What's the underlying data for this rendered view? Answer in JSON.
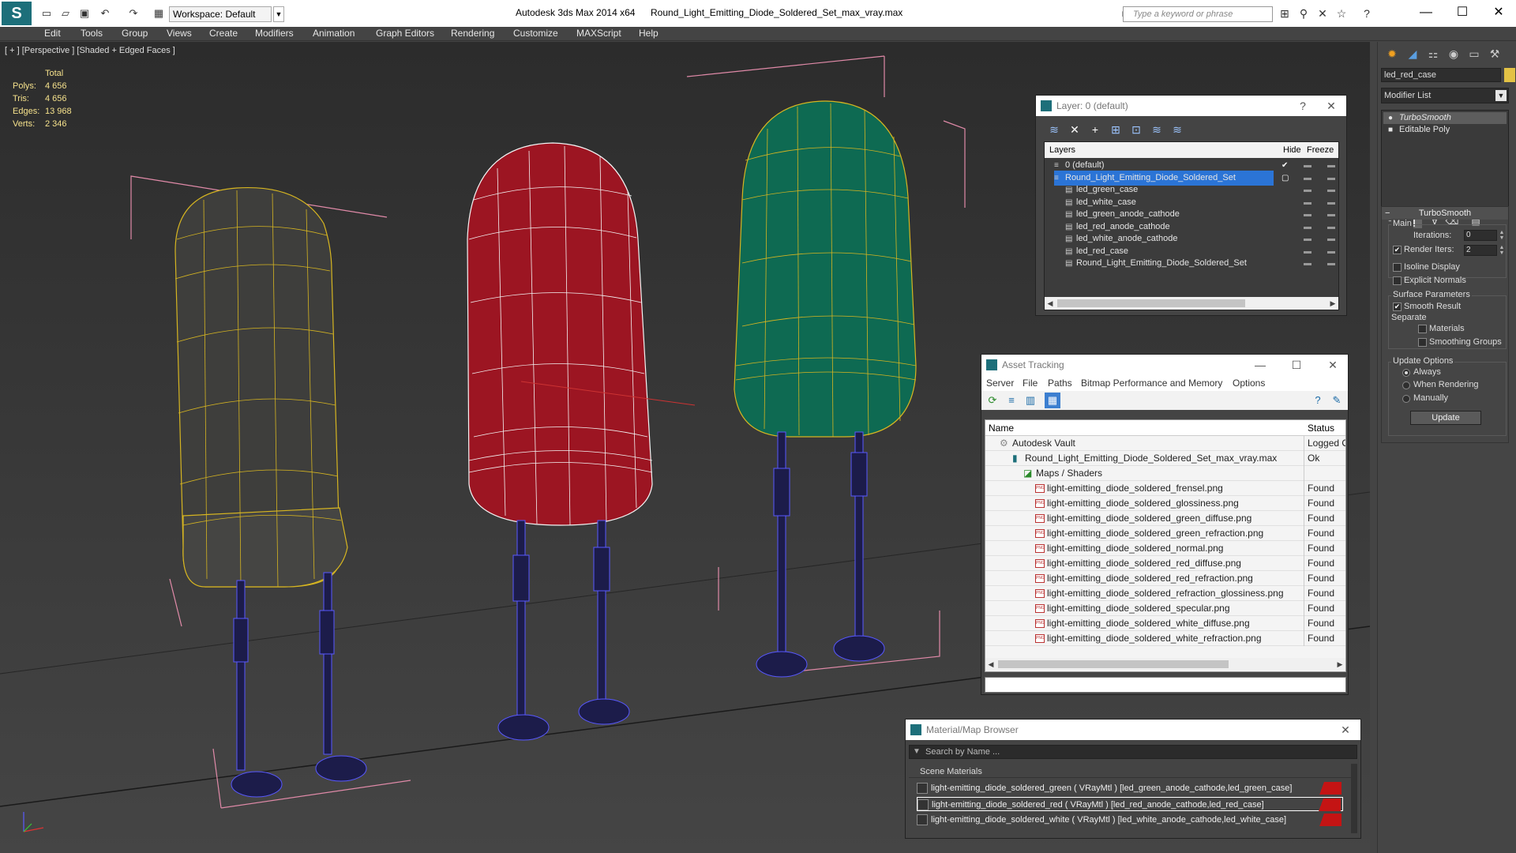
{
  "titlebar": {
    "workspace": "Workspace: Default",
    "app_title": "Autodesk 3ds Max  2014 x64",
    "doc_title": "Round_Light_Emitting_Diode_Soldered_Set_max_vray.max",
    "search_placeholder": "Type a keyword or phrase"
  },
  "menu": [
    "Edit",
    "Tools",
    "Group",
    "Views",
    "Create",
    "Modifiers",
    "Animation",
    "Graph Editors",
    "Rendering",
    "Customize",
    "MAXScript",
    "Help"
  ],
  "viewport": {
    "label": "[ + ] [Perspective ] [Shaded + Edged Faces ]",
    "stats": {
      "header": "Total",
      "polys_label": "Polys:",
      "polys": "4 656",
      "tris_label": "Tris:",
      "tris": "4 656",
      "edges_label": "Edges:",
      "edges": "13 968",
      "verts_label": "Verts:",
      "verts": "2 346"
    }
  },
  "command_panel": {
    "object_name": "led_red_case",
    "object_color": "#e3c245",
    "modifier_list": "Modifier List",
    "stack": [
      "TurboSmooth",
      "Editable Poly"
    ],
    "turbosmooth": {
      "title": "TurboSmooth",
      "main": "Main",
      "iterations_label": "Iterations:",
      "iterations": "0",
      "render_iters_label": "Render Iters:",
      "render_iters": "2",
      "isoline": "Isoline Display",
      "explicit_normals": "Explicit Normals",
      "surface_params": "Surface Parameters",
      "smooth_result": "Smooth Result",
      "separate": "Separate",
      "materials": "Materials",
      "smoothing_groups": "Smoothing Groups",
      "update_options": "Update Options",
      "always": "Always",
      "when_rendering": "When Rendering",
      "manually": "Manually",
      "update_button": "Update"
    }
  },
  "layer_window": {
    "title": "Layer: 0 (default)",
    "col_layers": "Layers",
    "col_hide": "Hide",
    "col_freeze": "Freeze",
    "rows": [
      {
        "name": "0 (default)",
        "indent": 0
      },
      {
        "name": "Round_Light_Emitting_Diode_Soldered_Set",
        "indent": 0,
        "selected": true
      },
      {
        "name": "led_green_case",
        "indent": 1
      },
      {
        "name": "led_white_case",
        "indent": 1
      },
      {
        "name": "led_green_anode_cathode",
        "indent": 1
      },
      {
        "name": "led_red_anode_cathode",
        "indent": 1
      },
      {
        "name": "led_white_anode_cathode",
        "indent": 1
      },
      {
        "name": "led_red_case",
        "indent": 1
      },
      {
        "name": "Round_Light_Emitting_Diode_Soldered_Set",
        "indent": 1
      }
    ]
  },
  "asset_window": {
    "title": "Asset Tracking",
    "menu": [
      "Server",
      "File",
      "Paths",
      "Bitmap Performance and Memory",
      "Options"
    ],
    "col_name": "Name",
    "col_status": "Status",
    "rows": [
      {
        "name": "Autodesk Vault",
        "status": "Logged Out",
        "level": 0
      },
      {
        "name": "Round_Light_Emitting_Diode_Soldered_Set_max_vray.max",
        "status": "Ok",
        "level": 1
      },
      {
        "name": "Maps / Shaders",
        "status": "",
        "level": 2
      },
      {
        "name": "light-emitting_diode_soldered_frensel.png",
        "status": "Found",
        "level": 3
      },
      {
        "name": "light-emitting_diode_soldered_glossiness.png",
        "status": "Found",
        "level": 3
      },
      {
        "name": "light-emitting_diode_soldered_green_diffuse.png",
        "status": "Found",
        "level": 3
      },
      {
        "name": "light-emitting_diode_soldered_green_refraction.png",
        "status": "Found",
        "level": 3
      },
      {
        "name": "light-emitting_diode_soldered_normal.png",
        "status": "Found",
        "level": 3
      },
      {
        "name": "light-emitting_diode_soldered_red_diffuse.png",
        "status": "Found",
        "level": 3
      },
      {
        "name": "light-emitting_diode_soldered_red_refraction.png",
        "status": "Found",
        "level": 3
      },
      {
        "name": "light-emitting_diode_soldered_refraction_glossiness.png",
        "status": "Found",
        "level": 3
      },
      {
        "name": "light-emitting_diode_soldered_specular.png",
        "status": "Found",
        "level": 3
      },
      {
        "name": "light-emitting_diode_soldered_white_diffuse.png",
        "status": "Found",
        "level": 3
      },
      {
        "name": "light-emitting_diode_soldered_white_refraction.png",
        "status": "Found",
        "level": 3
      }
    ]
  },
  "material_window": {
    "title": "Material/Map Browser",
    "search_placeholder": "Search by Name ...",
    "section": "Scene Materials",
    "materials": [
      "light-emitting_diode_soldered_green ( VRayMtl ) [led_green_anode_cathode,led_green_case]",
      "light-emitting_diode_soldered_red ( VRayMtl ) [led_red_anode_cathode,led_red_case]",
      "light-emitting_diode_soldered_white ( VRayMtl ) [led_white_anode_cathode,led_white_case]"
    ]
  },
  "colors": {
    "green_led": "#0e6a52",
    "red_led": "#9c1522",
    "white_led": "#4a4a48",
    "leads": "#2a2a6a",
    "selection": "#2b74d6"
  }
}
